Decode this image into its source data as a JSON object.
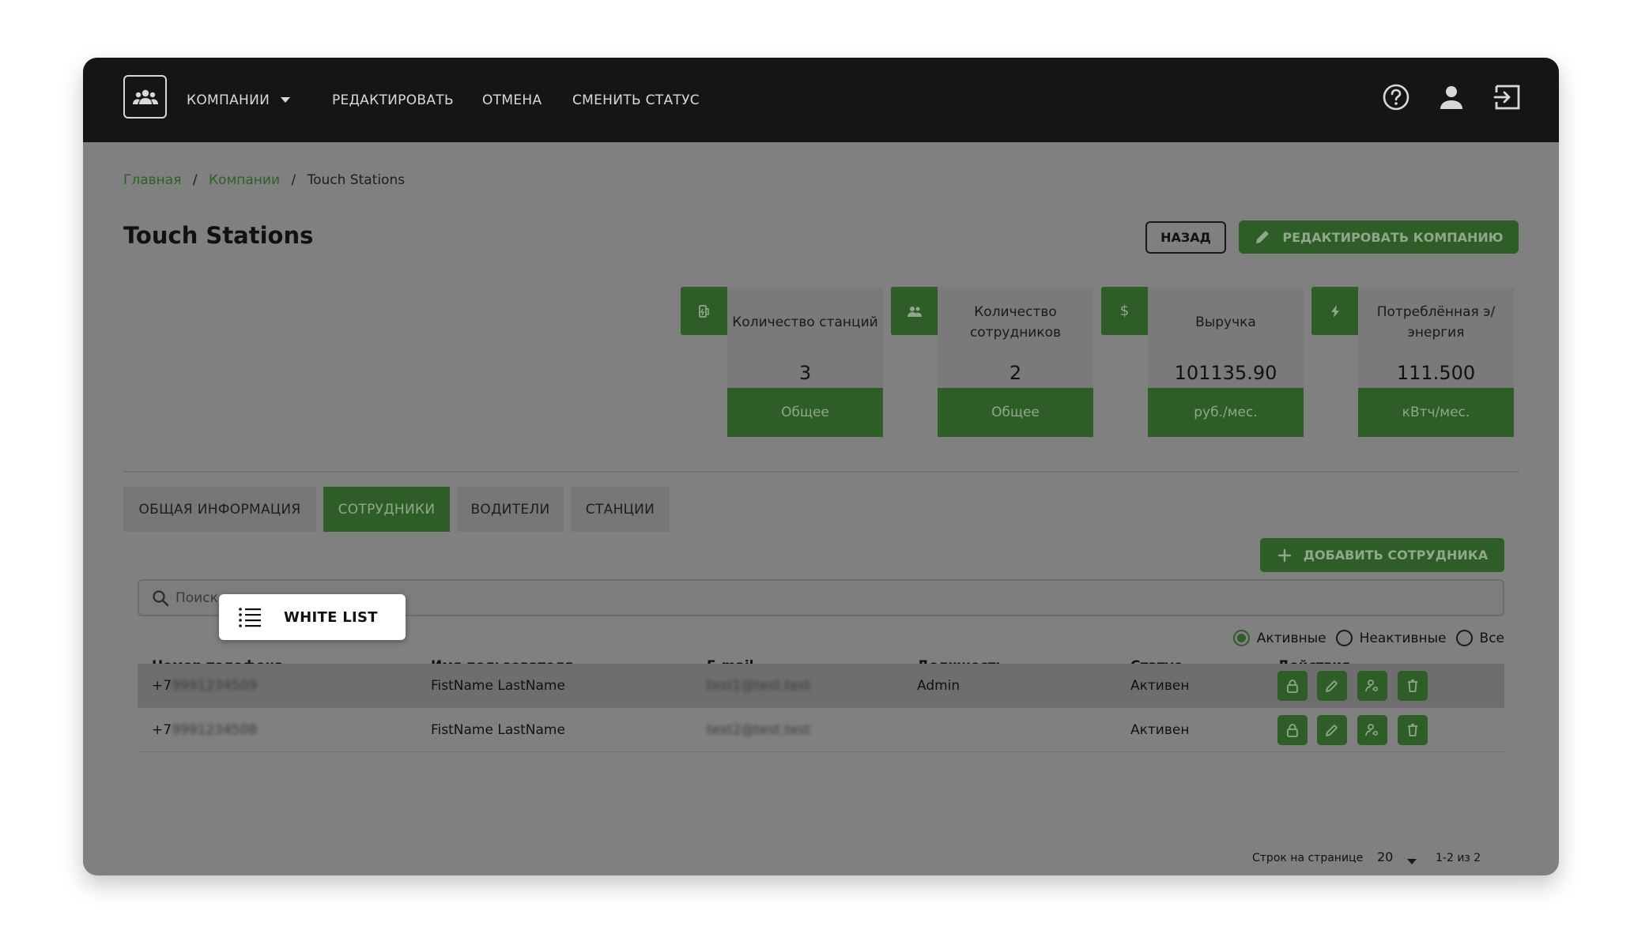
{
  "colors": {
    "brand_green": "#2e5d27",
    "topbar": "#151515",
    "overlay_gray": "#808080"
  },
  "topbar": {
    "logo_icon": "users-group-icon",
    "nav": [
      {
        "label": "КОМПАНИИ",
        "has_dropdown": true
      },
      {
        "label": "РЕДАКТИРОВАТЬ"
      },
      {
        "label": "ОТМЕНА"
      },
      {
        "label": "СМЕНИТЬ СТАТУС"
      }
    ],
    "icons": [
      "help-circle-icon",
      "user-icon",
      "logout-icon"
    ]
  },
  "breadcrumbs": [
    "Главная",
    "Компании",
    "Touch Stations"
  ],
  "page": {
    "title": "Touch Stations",
    "back_label": "НАЗАД",
    "edit_label": "РЕДАКТИРОВАТЬ КОМПАНИЮ"
  },
  "stats": [
    {
      "icon": "ev-station-icon",
      "label": "Количество станций",
      "value": "3",
      "footer": "Общее"
    },
    {
      "icon": "people-icon",
      "label": "Количество сотрудников",
      "value": "2",
      "footer": "Общее"
    },
    {
      "icon": "dollar-icon",
      "label": "Выручка",
      "value": "101135.90",
      "footer": "руб./мес."
    },
    {
      "icon": "lightning-icon",
      "label": "Потреблённая э/энергия",
      "value": "111.500",
      "footer": "кВтч/мес."
    }
  ],
  "tabs": [
    {
      "label": "ОБЩАЯ ИНФОРМАЦИЯ",
      "active": false
    },
    {
      "label": "СОТРУДНИКИ",
      "active": true
    },
    {
      "label": "ВОДИТЕЛИ",
      "active": false
    },
    {
      "label": "СТАНЦИИ",
      "active": false
    }
  ],
  "white_list": {
    "label": "WHITE LIST",
    "icon": "list-icon"
  },
  "add_employee_label": "ДОБАВИТЬ СОТРУДНИКА",
  "search": {
    "placeholder": "Поиск",
    "value": ""
  },
  "filters": {
    "options": [
      "Активные",
      "Неактивные",
      "Все"
    ],
    "selected": "Активные"
  },
  "table": {
    "columns": [
      "Номер телефона",
      "Имя пользователя",
      "E-mail",
      "Должность",
      "Статус",
      "Действия"
    ],
    "rows": [
      {
        "phone_prefix": "+7",
        "phone_hidden": "9991234509",
        "name": "FistName LastName",
        "email": "test1@test.test",
        "position": "Admin",
        "status": "Активен"
      },
      {
        "phone_prefix": "+7",
        "phone_hidden": "9991234508",
        "name": "FistName LastName",
        "email": "test2@test.test",
        "position": "",
        "status": "Активен"
      }
    ],
    "action_icons": [
      "lock-icon",
      "pencil-icon",
      "person-key-icon",
      "trash-icon"
    ]
  },
  "pagination": {
    "rows_label": "Строк на странице",
    "rows_per_page": "20",
    "range": "1-2 из 2"
  }
}
